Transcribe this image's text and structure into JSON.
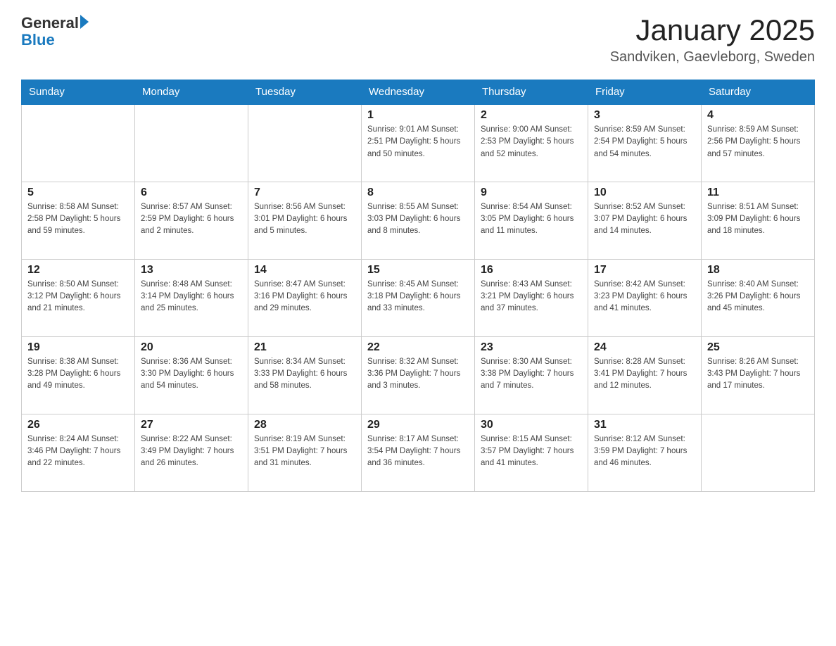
{
  "header": {
    "logo_text_general": "General",
    "logo_text_blue": "Blue",
    "title": "January 2025",
    "subtitle": "Sandviken, Gaevleborg, Sweden"
  },
  "days_of_week": [
    "Sunday",
    "Monday",
    "Tuesday",
    "Wednesday",
    "Thursday",
    "Friday",
    "Saturday"
  ],
  "weeks": [
    [
      {
        "day": "",
        "info": ""
      },
      {
        "day": "",
        "info": ""
      },
      {
        "day": "",
        "info": ""
      },
      {
        "day": "1",
        "info": "Sunrise: 9:01 AM\nSunset: 2:51 PM\nDaylight: 5 hours\nand 50 minutes."
      },
      {
        "day": "2",
        "info": "Sunrise: 9:00 AM\nSunset: 2:53 PM\nDaylight: 5 hours\nand 52 minutes."
      },
      {
        "day": "3",
        "info": "Sunrise: 8:59 AM\nSunset: 2:54 PM\nDaylight: 5 hours\nand 54 minutes."
      },
      {
        "day": "4",
        "info": "Sunrise: 8:59 AM\nSunset: 2:56 PM\nDaylight: 5 hours\nand 57 minutes."
      }
    ],
    [
      {
        "day": "5",
        "info": "Sunrise: 8:58 AM\nSunset: 2:58 PM\nDaylight: 5 hours\nand 59 minutes."
      },
      {
        "day": "6",
        "info": "Sunrise: 8:57 AM\nSunset: 2:59 PM\nDaylight: 6 hours\nand 2 minutes."
      },
      {
        "day": "7",
        "info": "Sunrise: 8:56 AM\nSunset: 3:01 PM\nDaylight: 6 hours\nand 5 minutes."
      },
      {
        "day": "8",
        "info": "Sunrise: 8:55 AM\nSunset: 3:03 PM\nDaylight: 6 hours\nand 8 minutes."
      },
      {
        "day": "9",
        "info": "Sunrise: 8:54 AM\nSunset: 3:05 PM\nDaylight: 6 hours\nand 11 minutes."
      },
      {
        "day": "10",
        "info": "Sunrise: 8:52 AM\nSunset: 3:07 PM\nDaylight: 6 hours\nand 14 minutes."
      },
      {
        "day": "11",
        "info": "Sunrise: 8:51 AM\nSunset: 3:09 PM\nDaylight: 6 hours\nand 18 minutes."
      }
    ],
    [
      {
        "day": "12",
        "info": "Sunrise: 8:50 AM\nSunset: 3:12 PM\nDaylight: 6 hours\nand 21 minutes."
      },
      {
        "day": "13",
        "info": "Sunrise: 8:48 AM\nSunset: 3:14 PM\nDaylight: 6 hours\nand 25 minutes."
      },
      {
        "day": "14",
        "info": "Sunrise: 8:47 AM\nSunset: 3:16 PM\nDaylight: 6 hours\nand 29 minutes."
      },
      {
        "day": "15",
        "info": "Sunrise: 8:45 AM\nSunset: 3:18 PM\nDaylight: 6 hours\nand 33 minutes."
      },
      {
        "day": "16",
        "info": "Sunrise: 8:43 AM\nSunset: 3:21 PM\nDaylight: 6 hours\nand 37 minutes."
      },
      {
        "day": "17",
        "info": "Sunrise: 8:42 AM\nSunset: 3:23 PM\nDaylight: 6 hours\nand 41 minutes."
      },
      {
        "day": "18",
        "info": "Sunrise: 8:40 AM\nSunset: 3:26 PM\nDaylight: 6 hours\nand 45 minutes."
      }
    ],
    [
      {
        "day": "19",
        "info": "Sunrise: 8:38 AM\nSunset: 3:28 PM\nDaylight: 6 hours\nand 49 minutes."
      },
      {
        "day": "20",
        "info": "Sunrise: 8:36 AM\nSunset: 3:30 PM\nDaylight: 6 hours\nand 54 minutes."
      },
      {
        "day": "21",
        "info": "Sunrise: 8:34 AM\nSunset: 3:33 PM\nDaylight: 6 hours\nand 58 minutes."
      },
      {
        "day": "22",
        "info": "Sunrise: 8:32 AM\nSunset: 3:36 PM\nDaylight: 7 hours\nand 3 minutes."
      },
      {
        "day": "23",
        "info": "Sunrise: 8:30 AM\nSunset: 3:38 PM\nDaylight: 7 hours\nand 7 minutes."
      },
      {
        "day": "24",
        "info": "Sunrise: 8:28 AM\nSunset: 3:41 PM\nDaylight: 7 hours\nand 12 minutes."
      },
      {
        "day": "25",
        "info": "Sunrise: 8:26 AM\nSunset: 3:43 PM\nDaylight: 7 hours\nand 17 minutes."
      }
    ],
    [
      {
        "day": "26",
        "info": "Sunrise: 8:24 AM\nSunset: 3:46 PM\nDaylight: 7 hours\nand 22 minutes."
      },
      {
        "day": "27",
        "info": "Sunrise: 8:22 AM\nSunset: 3:49 PM\nDaylight: 7 hours\nand 26 minutes."
      },
      {
        "day": "28",
        "info": "Sunrise: 8:19 AM\nSunset: 3:51 PM\nDaylight: 7 hours\nand 31 minutes."
      },
      {
        "day": "29",
        "info": "Sunrise: 8:17 AM\nSunset: 3:54 PM\nDaylight: 7 hours\nand 36 minutes."
      },
      {
        "day": "30",
        "info": "Sunrise: 8:15 AM\nSunset: 3:57 PM\nDaylight: 7 hours\nand 41 minutes."
      },
      {
        "day": "31",
        "info": "Sunrise: 8:12 AM\nSunset: 3:59 PM\nDaylight: 7 hours\nand 46 minutes."
      },
      {
        "day": "",
        "info": ""
      }
    ]
  ]
}
